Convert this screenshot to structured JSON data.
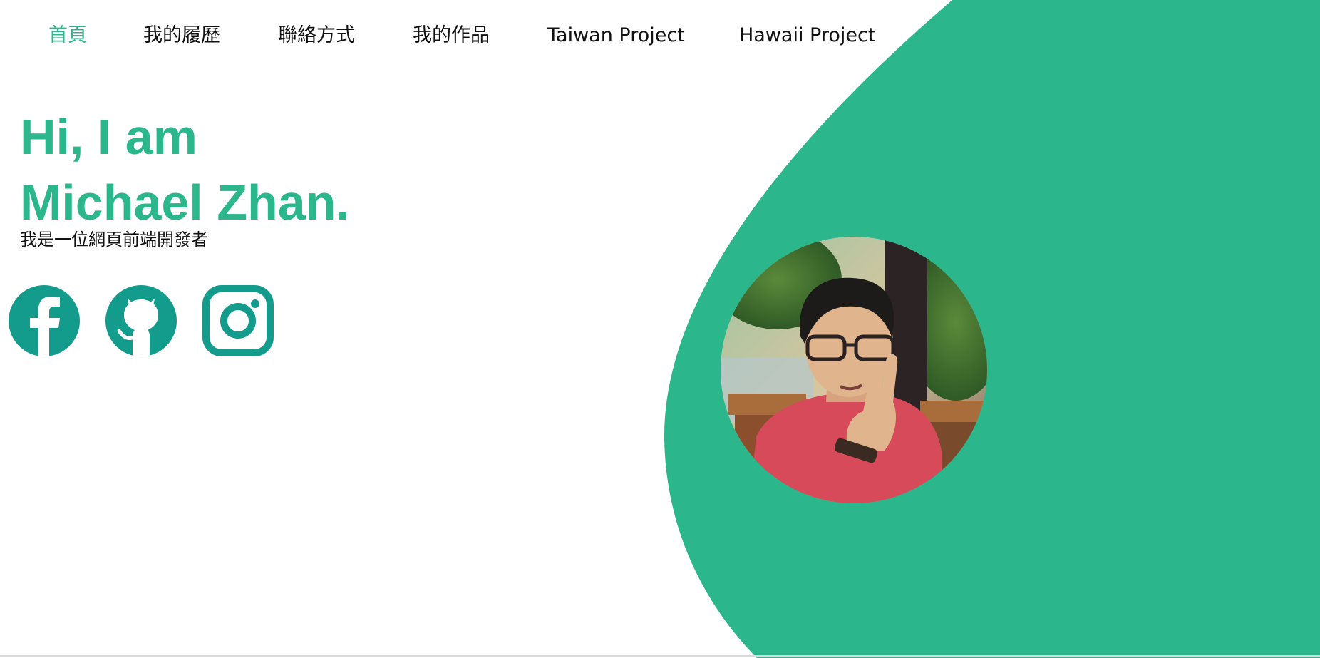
{
  "nav": {
    "items": [
      {
        "label": "首頁",
        "active": true
      },
      {
        "label": "我的履歷",
        "active": false
      },
      {
        "label": "聯絡方式",
        "active": false
      },
      {
        "label": "我的作品",
        "active": false
      },
      {
        "label": "Taiwan Project",
        "active": false
      },
      {
        "label": "Hawaii Project",
        "active": false
      }
    ]
  },
  "hero": {
    "title_line1": "Hi, I am",
    "title_line2": "Michael Zhan.",
    "subtitle": "我是一位網頁前端開發者"
  },
  "social": [
    {
      "icon": "facebook-icon"
    },
    {
      "icon": "github-icon"
    },
    {
      "icon": "instagram-icon"
    }
  ],
  "colors": {
    "accent": "#2bb78b",
    "icon": "#139b8c",
    "text": "#111111",
    "background": "#ffffff"
  }
}
